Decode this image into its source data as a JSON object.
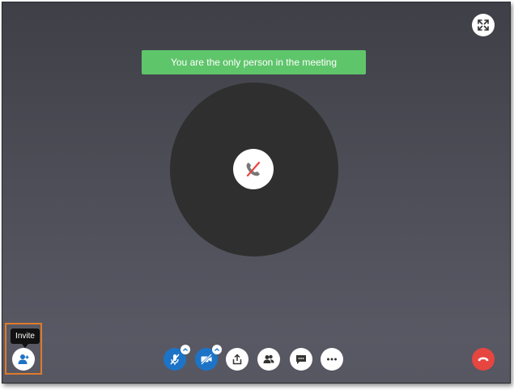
{
  "banner": {
    "text": "You are the only person in the meeting"
  },
  "invite": {
    "tooltip": "Invite"
  },
  "toolbar": {
    "buttons": [
      "invite",
      "microphone-muted",
      "video-off",
      "share-screen",
      "participants",
      "chat",
      "more-options",
      "end-call"
    ]
  },
  "colors": {
    "background": "#4a4a54",
    "banner": "#5fc56b",
    "accent_blue": "#1d74c7",
    "end_call_red": "#e64540",
    "highlight": "#e07b2a"
  },
  "icons": {
    "fullscreen": "expand-arrows-icon",
    "center_status": "muted-phone-icon",
    "invite": "add-person-icon",
    "microphone": "microphone-off-icon",
    "video": "camera-off-icon",
    "share": "share-upload-icon",
    "participants": "people-icon",
    "chat": "chat-bubble-icon",
    "more": "ellipsis-icon",
    "end_call": "hang-up-icon"
  }
}
